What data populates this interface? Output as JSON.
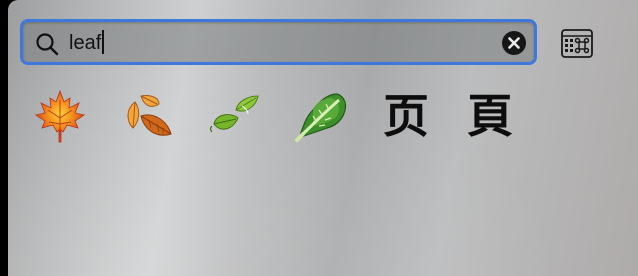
{
  "search": {
    "value": "leaf",
    "icon": "magnifying-glass-icon",
    "clear_icon": "clear-x-icon"
  },
  "keyboard_button": {
    "icon": "character-viewer-icon"
  },
  "results": [
    {
      "name": "maple-leaf",
      "char": "🍁",
      "kind": "emoji"
    },
    {
      "name": "fallen-leaf",
      "char": "🍂",
      "kind": "emoji"
    },
    {
      "name": "leaf-fluttering-in-wind",
      "char": "🍃",
      "kind": "emoji"
    },
    {
      "name": "leafy-green",
      "char": "🥬",
      "kind": "emoji"
    },
    {
      "name": "cjk-page-simplified",
      "char": "页",
      "kind": "glyph"
    },
    {
      "name": "cjk-page-traditional",
      "char": "頁",
      "kind": "glyph"
    }
  ],
  "colors": {
    "focus_ring": "#3f78dd",
    "clear_button": "#161616",
    "text": "#111111"
  }
}
